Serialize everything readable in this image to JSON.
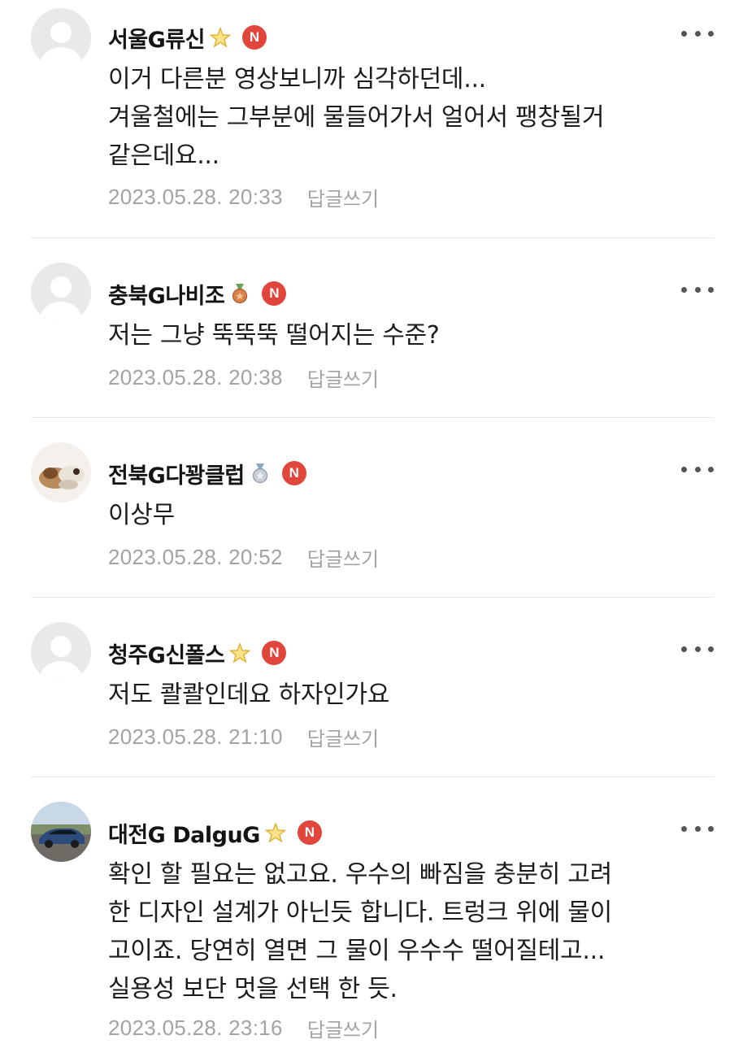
{
  "comments": [
    {
      "author": "서울G류신",
      "grade_icon": "star-icon",
      "badge": "N",
      "avatar": "default-avatar",
      "lines": [
        "이거 다른분 영상보니까 심각하던데...",
        "겨울철에는 그부분에 물들어가서 얼어서 팽창될거",
        "같은데요..."
      ],
      "timestamp": "2023.05.28. 20:33",
      "reply_label": "답글쓰기"
    },
    {
      "author": "충북G나비조",
      "grade_icon": "bronze-medal-icon",
      "badge": "N",
      "avatar": "default-avatar",
      "lines": [
        "저는 그냥 뚝뚝뚝 떨어지는 수준?"
      ],
      "timestamp": "2023.05.28. 20:38",
      "reply_label": "답글쓰기"
    },
    {
      "author": "전북G다꽝클럽",
      "grade_icon": "silver-medal-icon",
      "badge": "N",
      "avatar": "photo-avatar",
      "lines": [
        "이상무"
      ],
      "timestamp": "2023.05.28. 20:52",
      "reply_label": "답글쓰기"
    },
    {
      "author": "청주G신폴스",
      "grade_icon": "star-icon",
      "badge": "N",
      "avatar": "default-avatar",
      "lines": [
        "저도 콸콸인데요 하자인가요"
      ],
      "timestamp": "2023.05.28. 21:10",
      "reply_label": "답글쓰기"
    },
    {
      "author": "대전G DalguG",
      "grade_icon": "star-icon",
      "badge": "N",
      "avatar": "car-photo-avatar",
      "lines": [
        "확인 할 필요는 없고요. 우수의 빠짐을 충분히 고려",
        "한 디자인 설계가 아닌듯 합니다. 트렁크 위에 물이",
        "고이죠. 당연히 열면 그 물이 우수수 떨어질테고...",
        "실용성 보단 멋을 선택 한 듯."
      ],
      "timestamp": "2023.05.28. 23:16",
      "reply_label": "답글쓰기"
    }
  ],
  "colors": {
    "badge": "#e0463b",
    "muted_text": "#a3a3a3",
    "divider": "#e8e8e8",
    "star": "#f2c230"
  }
}
